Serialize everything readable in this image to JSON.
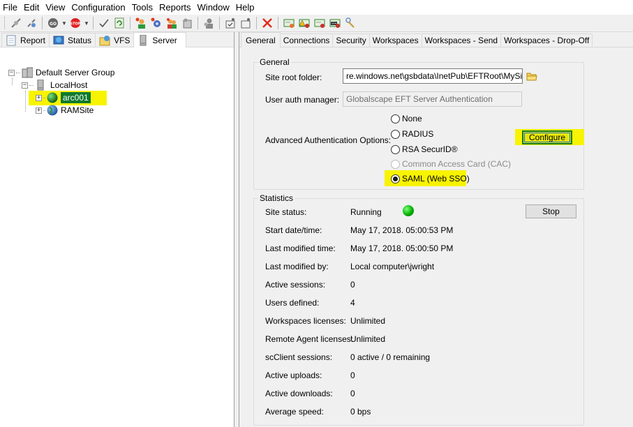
{
  "menu": [
    "File",
    "Edit",
    "View",
    "Configuration",
    "Tools",
    "Reports",
    "Window",
    "Help"
  ],
  "toolbar": {
    "buttons": [
      {
        "icon": "connect-icon"
      },
      {
        "icon": "disconnect-icon"
      },
      {
        "icon": "go-icon",
        "dropdown": true
      },
      {
        "icon": "stop-icon",
        "dropdown": true
      },
      {
        "icon": "apply-check-icon"
      },
      {
        "icon": "refresh-icon"
      },
      {
        "icon": "new-user-icon"
      },
      {
        "icon": "new-event-rule-icon"
      },
      {
        "icon": "new-group-icon"
      },
      {
        "icon": "new-command-icon"
      },
      {
        "icon": "user-disabled-icon"
      },
      {
        "icon": "new-folder-check-icon"
      },
      {
        "icon": "new-folder-icon"
      },
      {
        "icon": "delete-icon"
      },
      {
        "icon": "certificate-new-icon"
      },
      {
        "icon": "certificate-warning-icon"
      },
      {
        "icon": "certificate-icon"
      },
      {
        "icon": "ssh-key-icon"
      },
      {
        "icon": "key-manager-icon"
      }
    ]
  },
  "left_tabs": [
    {
      "label": "Report",
      "icon": "report-icon"
    },
    {
      "label": "Status",
      "icon": "status-icon"
    },
    {
      "label": "VFS",
      "icon": "vfs-icon"
    },
    {
      "label": "Server",
      "icon": "server-icon",
      "active": true
    }
  ],
  "tree": {
    "root": "Default Server Group",
    "host": "LocalHost",
    "sites": [
      {
        "label": "arc001",
        "selected": true,
        "highlight": true
      },
      {
        "label": "RAMSite"
      }
    ]
  },
  "right_tabs": [
    {
      "label": "General",
      "active": true
    },
    {
      "label": "Connections"
    },
    {
      "label": "Security"
    },
    {
      "label": "Workspaces"
    },
    {
      "label": "Workspaces - Send"
    },
    {
      "label": "Workspaces - Drop-Off"
    }
  ],
  "general": {
    "title": "General",
    "site_root_label": "Site root folder:",
    "site_root_value": "re.windows.net\\gsbdata\\InetPub\\EFTRoot\\MySite\\",
    "auth_manager_label": "User auth manager:",
    "auth_manager_value": "Globalscape EFT Server Authentication",
    "adv_auth_label": "Advanced Authentication Options:",
    "adv_auth_options": [
      {
        "label": "None",
        "checked": false,
        "disabled": false
      },
      {
        "label": "RADIUS",
        "checked": false,
        "disabled": false
      },
      {
        "label": "RSA SecurID®",
        "checked": false,
        "disabled": false
      },
      {
        "label": "Common Access Card (CAC)",
        "checked": false,
        "disabled": true
      },
      {
        "label": "SAML (Web SSO)",
        "checked": true,
        "disabled": false
      }
    ],
    "configure_label": "Configure"
  },
  "statistics": {
    "title": "Statistics",
    "stop_label": "Stop",
    "status_color": "#00c000",
    "rows": [
      {
        "label": "Site status:",
        "value": "Running"
      },
      {
        "label": "Start date/time:",
        "value": "May 17, 2018. 05:00:53 PM"
      },
      {
        "label": "Last modified time:",
        "value": "May 17, 2018. 05:00:50 PM"
      },
      {
        "label": "Last modified by:",
        "value": "Local computer\\jwright"
      },
      {
        "label": "Active sessions:",
        "value": "0"
      },
      {
        "label": "Users defined:",
        "value": "4"
      },
      {
        "label": "Workspaces licenses:",
        "value": "Unlimited"
      },
      {
        "label": "Remote Agent licenses:",
        "value": "Unlimited"
      },
      {
        "label": "scClient sessions:",
        "value": "0 active / 0 remaining"
      },
      {
        "label": "Active uploads:",
        "value": "0"
      },
      {
        "label": "Active downloads:",
        "value": "0"
      },
      {
        "label": "Average speed:",
        "value": "0 bps"
      }
    ]
  },
  "colors": {
    "highlight": "#f8f300",
    "selection": "#0f7a2e"
  }
}
